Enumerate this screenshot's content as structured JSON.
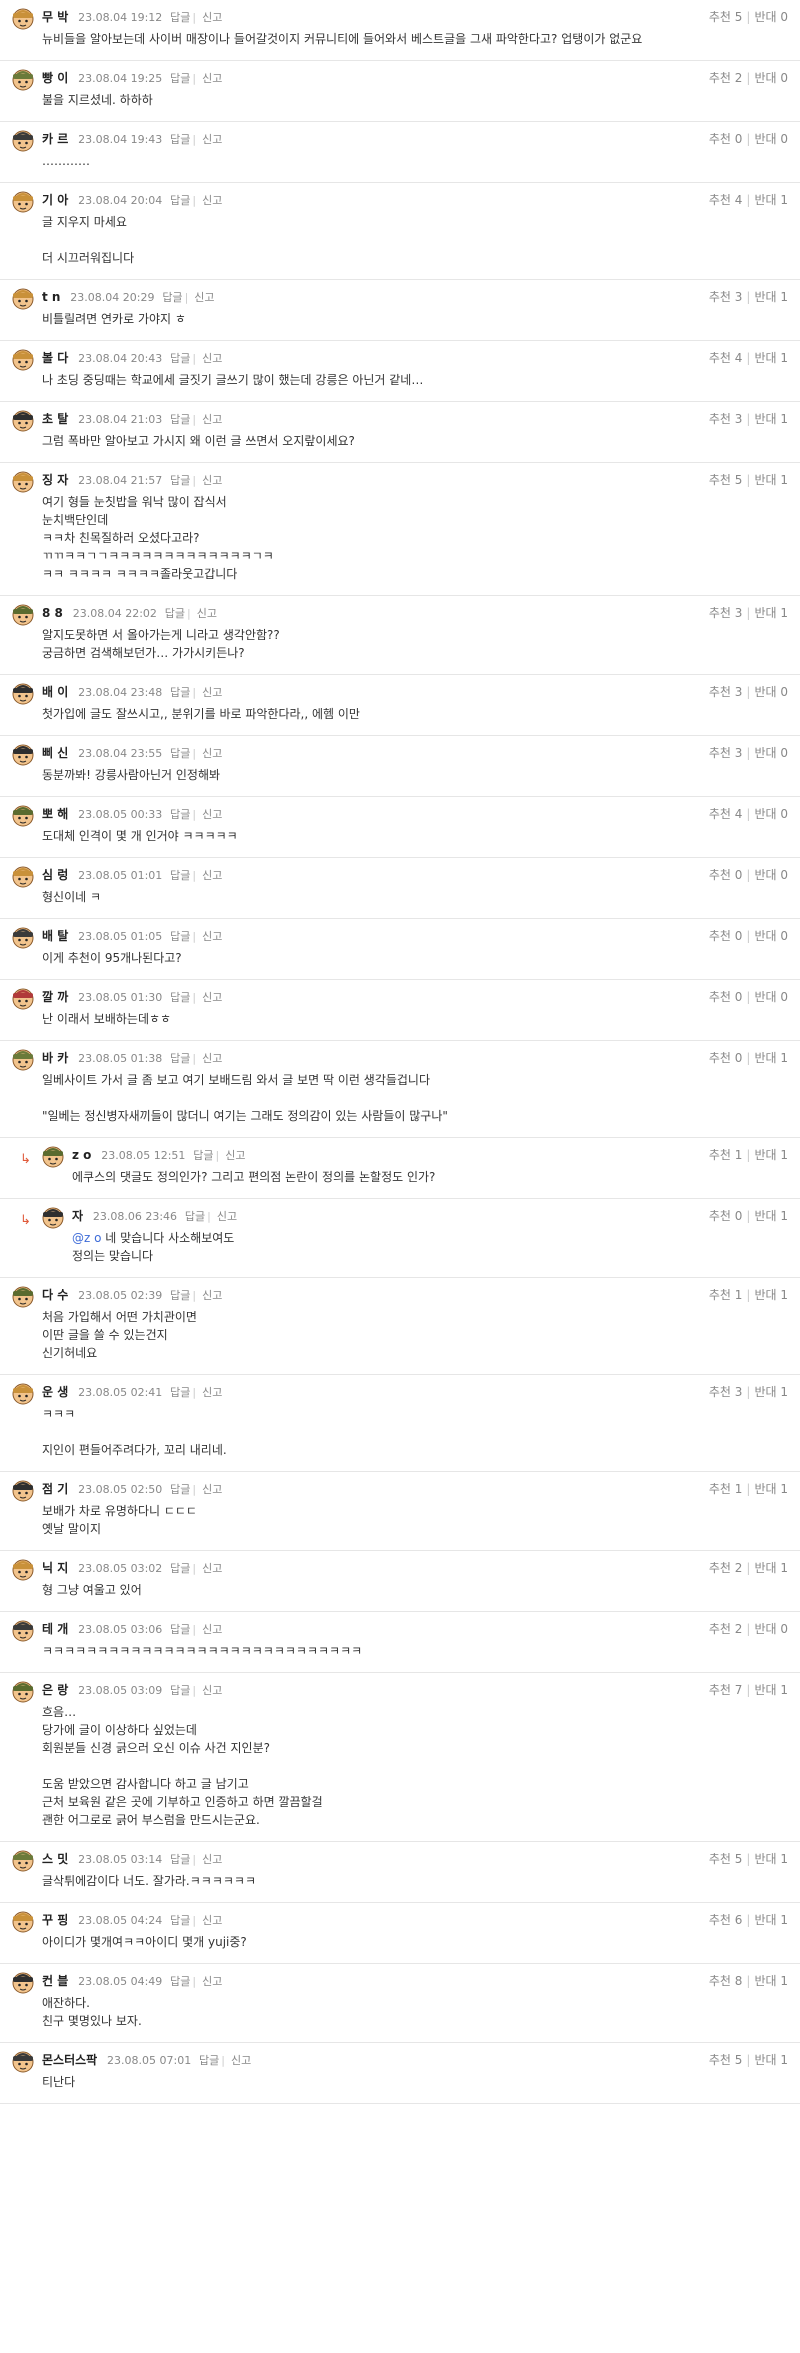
{
  "labels": {
    "reply": "답글",
    "report": "신고",
    "up": "추천",
    "down": "반대"
  },
  "comments": [
    {
      "nick": "무 박",
      "date": "23.08.04 19:12",
      "up": 5,
      "down": 0,
      "body": "뉴비들을 알아보는데 사이버 매장이나 들어갈것이지 커뮤니티에 들어와서 베스트글을 그새 파악한다고? 업탱이가 없군요",
      "av": "#c9913a"
    },
    {
      "nick": "빵 이",
      "date": "23.08.04 19:25",
      "up": 2,
      "down": 0,
      "body": "불을 지르셨네. 하하하",
      "av": "#6b7a3a"
    },
    {
      "nick": "카 르",
      "date": "23.08.04 19:43",
      "up": 0,
      "down": 0,
      "body": "…………",
      "av": "#3a3a3a"
    },
    {
      "nick": "기 아",
      "date": "23.08.04 20:04",
      "up": 4,
      "down": 1,
      "body": "글 지우지 마세요\n\n더 시끄러워집니다",
      "av": "#c9913a"
    },
    {
      "nick": "t n",
      "date": "23.08.04 20:29",
      "up": 3,
      "down": 1,
      "body": "비틀릴려면 연카로 가야지 ㅎ",
      "av": "#c9913a"
    },
    {
      "nick": "볼 다",
      "date": "23.08.04 20:43",
      "up": 4,
      "down": 1,
      "body": "나 초딩 중딩때는 학교에세 글짓기 글쓰기 많이 했는데 강릉은 아닌거 같네…",
      "av": "#c9913a"
    },
    {
      "nick": "초 탈",
      "date": "23.08.04 21:03",
      "up": 3,
      "down": 1,
      "body": "그럼 폭바만 알아보고 가시지 왜 이런 글 쓰면서 오지랖이세요?",
      "av": "#2f2f2f"
    },
    {
      "nick": "징 자",
      "date": "23.08.04 21:57",
      "up": 5,
      "down": 1,
      "body": "여기 형들 눈칫밥을 워낙 많이 잡식서\n눈치백단인데\nㅋㅋ차 친목질하러 오셨다고라?\nㄲㄲㅋㅋㄱㄱㅋㅋㅋㅋㅋㅋㅋㅋㅋㅋㅋㅋㅋㄱㅋ\nㅋㅋ ㅋㅋㅋㅋ ㅋㅋㅋㅋ졸라웃고갑니다",
      "av": "#c9913a"
    },
    {
      "nick": "8 8",
      "date": "23.08.04 22:02",
      "up": 3,
      "down": 1,
      "body": "알지도못하면 서 올아가는게 니라고 생각안함??\n궁금하면 검색해보던가… 가가시키든나?",
      "av": "#5a6b2f"
    },
    {
      "nick": "배 이",
      "date": "23.08.04 23:48",
      "up": 3,
      "down": 0,
      "body": "첫가입에 글도 잘쓰시고,, 분위기를 바로 파악한다라,, 에헴 이만",
      "av": "#2f2f2f"
    },
    {
      "nick": "삐 신",
      "date": "23.08.04 23:55",
      "up": 3,
      "down": 0,
      "body": "동분까봐! 강릉사람아닌거 인정해봐",
      "av": "#2f2f2f"
    },
    {
      "nick": "뽀 해",
      "date": "23.08.05 00:33",
      "up": 4,
      "down": 0,
      "body": "도대체 인격이 몇 개 인거야 ㅋㅋㅋㅋㅋ",
      "av": "#5a6b2f"
    },
    {
      "nick": "심 렁",
      "date": "23.08.05 01:01",
      "up": 0,
      "down": 0,
      "body": "형신이네 ㅋ",
      "av": "#c9913a"
    },
    {
      "nick": "배 탈",
      "date": "23.08.05 01:05",
      "up": 0,
      "down": 0,
      "body": "이게 추천이 95개나된다고?",
      "av": "#3a3a3a"
    },
    {
      "nick": "깔 까",
      "date": "23.08.05 01:30",
      "up": 0,
      "down": 0,
      "body": "난 이래서 보배하는데ㅎㅎ",
      "av": "#b03a3a"
    },
    {
      "nick": "바 카",
      "date": "23.08.05 01:38",
      "up": 0,
      "down": 1,
      "body": "일베사이트 가서 글 좀 보고 여기 보배드림 와서 글 보면 딱 이런 생각들겁니다\n\n\"일베는 정신병자새끼들이 많더니 여기는 그래도 정의감이 있는 사람들이 많구나\"",
      "av": "#6b7a3a"
    },
    {
      "reply": true,
      "nick": "z o",
      "date": "23.08.05 12:51",
      "up": 1,
      "down": 1,
      "body": "에쿠스의 댓글도 정의인가? 그리고 편의점 논란이 정의를 논할정도 인가?",
      "av": "#5a6b2f"
    },
    {
      "reply": true,
      "nick": "자",
      "date": "23.08.06 23:46",
      "up": 0,
      "down": 1,
      "mention": "@z o",
      "body": "네 맞습니다 사소해보여도\n정의는 맞습니다",
      "av": "#2f2f2f"
    },
    {
      "nick": "다 수",
      "date": "23.08.05 02:39",
      "up": 1,
      "down": 1,
      "body": "처음 가입해서 어떤 가치관이면\n이딴 글을 쓸 수 있는건지\n신기허네요",
      "av": "#5a6b2f"
    },
    {
      "nick": "운 생",
      "date": "23.08.05 02:41",
      "up": 3,
      "down": 1,
      "body": "ㅋㅋㅋ\n\n지인이 편들어주려다가, 꼬리 내리네.",
      "av": "#c9913a"
    },
    {
      "nick": "점 기",
      "date": "23.08.05 02:50",
      "up": 1,
      "down": 1,
      "body": "보배가 차로 유명하다니 ㄷㄷㄷ\n옛날 말이지",
      "av": "#2f2f2f"
    },
    {
      "nick": "닉 지",
      "date": "23.08.05 03:02",
      "up": 2,
      "down": 1,
      "body": "형 그냥 여울고 있어",
      "av": "#c9913a"
    },
    {
      "nick": "테 개",
      "date": "23.08.05 03:06",
      "up": 2,
      "down": 0,
      "body": "ㅋㅋㅋㅋㅋㅋㅋㅋㅋㅋㅋㅋㅋㅋㅋㅋㅋㅋㅋㅋㅋㅋㅋㅋㅋㅋㅋㅋㅋ",
      "av": "#3a3a3a"
    },
    {
      "nick": "은 랑",
      "date": "23.08.05 03:09",
      "up": 7,
      "down": 1,
      "body": "흐음…\n당가에 글이 이상하다 싶었는데\n회원분들 신경 긁으러 오신 이슈 사건 지인분?\n\n도움 받았으면 감사합니다 하고 글 남기고\n근처 보육원 같은 곳에 기부하고 인증하고 하면 깔끔할걸\n괜한 어그로로 긁어 부스럼을 만드시는군요.",
      "av": "#5a6b2f"
    },
    {
      "nick": "스 밋",
      "date": "23.08.05 03:14",
      "up": 5,
      "down": 1,
      "body": "글삭튀에감이다 너도. 잘가라.ㅋㅋㅋㅋㅋㅋ",
      "av": "#6b7a3a"
    },
    {
      "nick": "꾸 핑",
      "date": "23.08.05 04:24",
      "up": 6,
      "down": 1,
      "body": "아이디가 몇개여ㅋㅋ아이디 몇개 yuji중?",
      "av": "#c9913a"
    },
    {
      "nick": "컨 블",
      "date": "23.08.05 04:49",
      "up": 8,
      "down": 1,
      "body": "애잔하다.\n친구 몇명있나 보자.",
      "av": "#2f2f2f"
    },
    {
      "nick": "몬스터스팍",
      "date": "23.08.05 07:01",
      "up": 5,
      "down": 1,
      "body": "티난다",
      "av": "#3a3a3a"
    }
  ]
}
